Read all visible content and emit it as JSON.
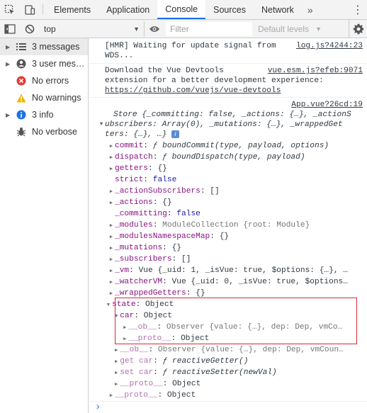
{
  "tabs": {
    "items": [
      {
        "label": "Elements",
        "active": false
      },
      {
        "label": "Application",
        "active": false
      },
      {
        "label": "Console",
        "active": true
      },
      {
        "label": "Sources",
        "active": false
      },
      {
        "label": "Network",
        "active": false
      }
    ],
    "more_label": "»",
    "menu_label": "⋮"
  },
  "toolbar": {
    "context": "top",
    "filter_placeholder": "Filter",
    "levels": "Default levels"
  },
  "sidebar": {
    "items": [
      {
        "label": "3 messages",
        "icon": "list-icon"
      },
      {
        "label": "3 user mess...",
        "icon": "user-icon"
      },
      {
        "label": "No errors",
        "icon": "error-icon"
      },
      {
        "label": "No warnings",
        "icon": "warning-icon"
      },
      {
        "label": "3 info",
        "icon": "info-icon"
      },
      {
        "label": "No verbose",
        "icon": "bug-icon"
      }
    ]
  },
  "console": {
    "msg1_text": "[HMR] Waiting for update signal from WDS...",
    "msg1_link": "log.js?4244:23",
    "msg2_text": "Download the Vue Devtools extension for a better development experience:",
    "msg2_url": "https://github.com/vuejs/vue-devtools",
    "msg2_link": "vue.esm.js?efeb:9071",
    "msg3_link": "App.vue?26cd:19",
    "store_line1": "Store {_committing: false, _actions: {…}, _actionS",
    "store_line2": "ubscribers: Array(0), _mutations: {…}, _wrappedGet",
    "store_line3": "ters: {…}, …}",
    "info_badge": "i",
    "prompt": "›"
  },
  "tree": [
    {
      "indent": 1,
      "arrow": "▶",
      "key": "commit",
      "sep": ": ",
      "val": "ƒ boundCommit(type, payload, options)"
    },
    {
      "indent": 1,
      "arrow": "▶",
      "key": "dispatch",
      "sep": ": ",
      "val": "ƒ boundDispatch(type, payload)"
    },
    {
      "indent": 1,
      "arrow": "▶",
      "key": "getters",
      "sep": ": ",
      "val": "{}"
    },
    {
      "indent": 1,
      "arrow": "",
      "key": "strict",
      "sep": ": ",
      "val": "false"
    },
    {
      "indent": 1,
      "arrow": "▶",
      "key": "_actionSubscribers",
      "sep": ": ",
      "val": "[]"
    },
    {
      "indent": 1,
      "arrow": "▶",
      "key": "_actions",
      "sep": ": ",
      "val": "{}"
    },
    {
      "indent": 1,
      "arrow": "",
      "key": "_committing",
      "sep": ": ",
      "val": "false"
    },
    {
      "indent": 1,
      "arrow": "▶",
      "key": "_modules",
      "sep": ": ",
      "val": "ModuleCollection {root: Module}"
    },
    {
      "indent": 1,
      "arrow": "▶",
      "key": "_modulesNamespaceMap",
      "sep": ": ",
      "val": "{}"
    },
    {
      "indent": 1,
      "arrow": "▶",
      "key": "_mutations",
      "sep": ": ",
      "val": "{}"
    },
    {
      "indent": 1,
      "arrow": "▶",
      "key": "_subscribers",
      "sep": ": ",
      "val": "[]"
    },
    {
      "indent": 1,
      "arrow": "▶",
      "key": "_vm",
      "sep": ": ",
      "val": "Vue {_uid: 1, _isVue: true, $options: {…}, …"
    },
    {
      "indent": 1,
      "arrow": "▶",
      "key": "_watcherVM",
      "sep": ": ",
      "val": "Vue {_uid: 0, _isVue: true, $options…"
    },
    {
      "indent": 1,
      "arrow": "▶",
      "key": "_wrappedGetters",
      "sep": ": ",
      "val": "{}"
    },
    {
      "indent": 0.6,
      "arrow": "▼",
      "key": "state",
      "sep": ": ",
      "val": "Object"
    },
    {
      "indent": 1.6,
      "arrow": "▼",
      "key": "car",
      "sep": ": ",
      "val": "Object"
    },
    {
      "indent": 2.6,
      "arrow": "▶",
      "key": "__ob__",
      "sep": ": ",
      "val": "Observer {value: {…}, dep: Dep, vmCo…"
    },
    {
      "indent": 2.6,
      "arrow": "▶",
      "key": "__proto__",
      "sep": ": ",
      "val": "Object"
    },
    {
      "indent": 1.6,
      "arrow": "▶",
      "key": "__ob__",
      "sep": ": ",
      "val": "Observer {value: {…}, dep: Dep, vmCoun…"
    },
    {
      "indent": 1.6,
      "arrow": "▶",
      "key": "get car",
      "sep": ": ",
      "val": "ƒ reactiveGetter()"
    },
    {
      "indent": 1.6,
      "arrow": "▶",
      "key": "set car",
      "sep": ": ",
      "val": "ƒ reactiveSetter(newVal)"
    },
    {
      "indent": 1.6,
      "arrow": "▶",
      "key": "__proto__",
      "sep": ": ",
      "val": "Object"
    },
    {
      "indent": 1,
      "arrow": "▶",
      "key": "__proto__",
      "sep": ": ",
      "val": "Object"
    }
  ]
}
